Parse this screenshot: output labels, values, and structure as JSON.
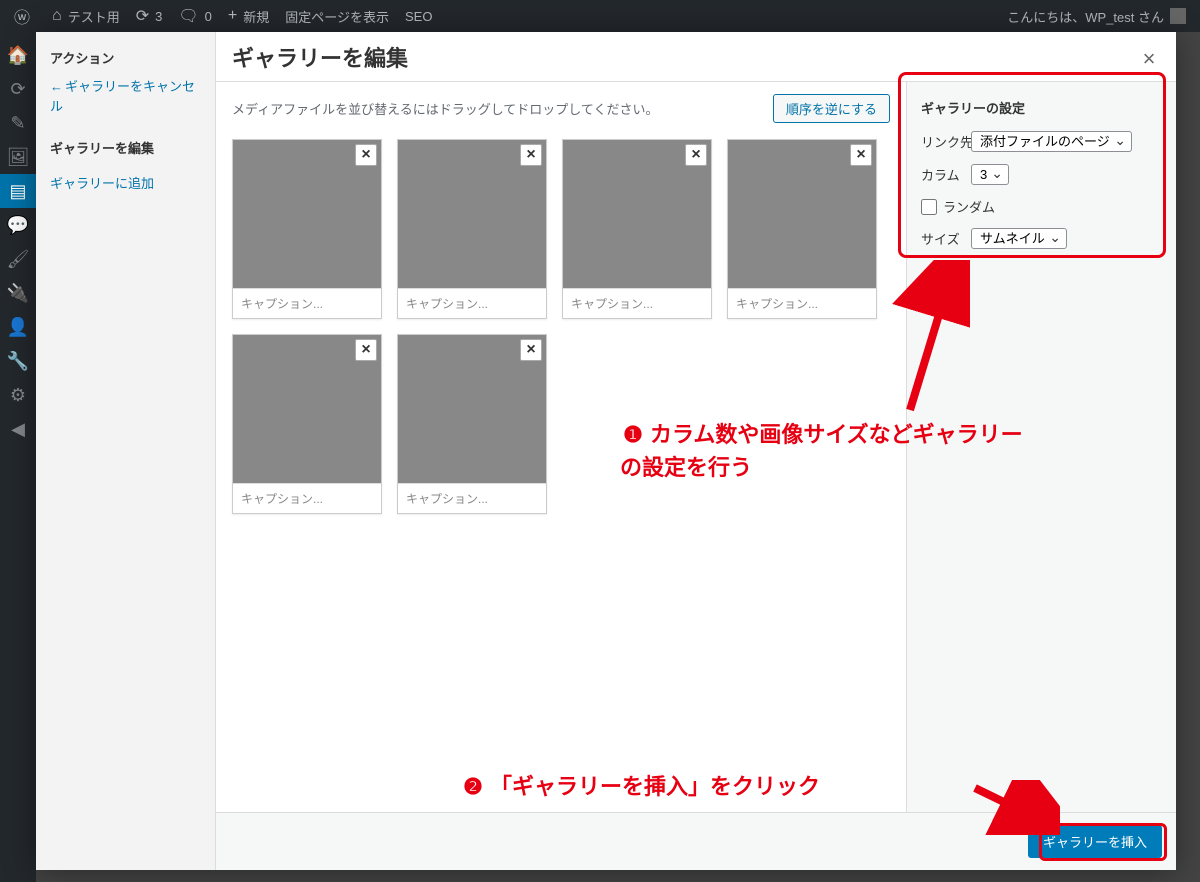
{
  "adminbar": {
    "site_name": "テスト用",
    "updates": "3",
    "comments": "0",
    "new": "新規",
    "view_page": "固定ページを表示",
    "seo": "SEO",
    "greeting": "こんにちは、WP_test さん"
  },
  "modal": {
    "title": "ギャラリーを編集",
    "sidebar": {
      "actions_heading": "アクション",
      "cancel_arrow": "←",
      "cancel": "ギャラリーをキャンセル",
      "edit_heading": "ギャラリーを編集",
      "add": "ギャラリーに追加"
    },
    "help_text": "メディアファイルを並び替えるにはドラッグしてドロップしてください。",
    "reverse_btn": "順序を逆にする",
    "caption_placeholder": "キャプション...",
    "insert_btn": "ギャラリーを挿入"
  },
  "gallery_settings": {
    "heading": "ギャラリーの設定",
    "link_label": "リンク先",
    "link_value": "添付ファイルのページ",
    "columns_label": "カラム",
    "columns_value": "3",
    "random_label": "ランダム",
    "size_label": "サイズ",
    "size_value": "サムネイル"
  },
  "annotations": {
    "callout1_num": "❶",
    "callout1_text": "カラム数や画像サイズなどギャラリーの設定を行う",
    "callout2_num": "❷",
    "callout2_text": "「ギャラリーを挿入」をクリック",
    "colors": {
      "highlight": "#e60012"
    }
  },
  "thumbnails": [
    1,
    2,
    3,
    4,
    5,
    6
  ]
}
